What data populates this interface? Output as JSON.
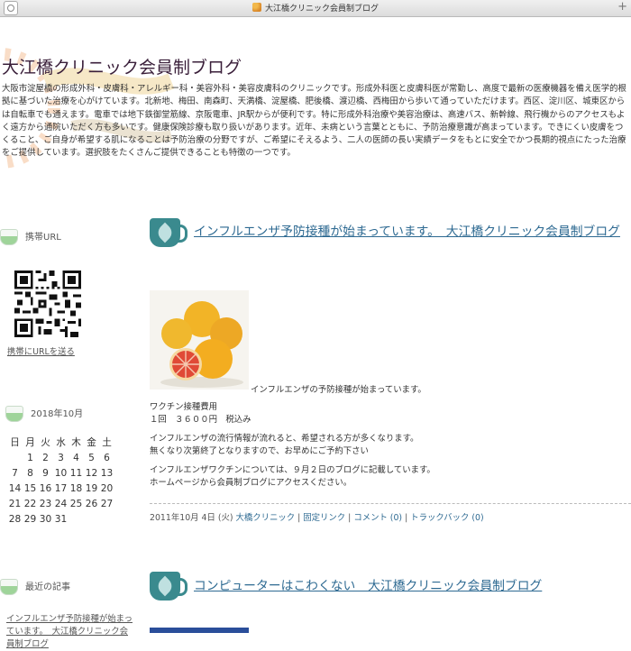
{
  "browser": {
    "tab_title": "大江橋クリニック会員制ブログ",
    "new_tab_symbol": "+"
  },
  "header": {
    "site_title": "大江橋クリニック会員制ブログ",
    "description": "大阪市淀屋橋の形成外科・皮膚科・アレルギー科・美容外科・美容皮膚科のクリニックです。形成外科医と皮膚科医が常勤し、高度で最新の医療機器を備え医学的根拠に基づいた治療を心がけています。北新地、梅田、南森町、天満橋、淀屋橋、肥後橋、渡辺橋、西梅田から歩いて通っていただけます。西区、淀川区、城東区からは自転車でも通えます。電車では地下鉄御堂筋線、京阪電車、JR駅からが便利です。特に形成外科治療や美容治療は、高速バス、新幹線、飛行機からのアクセスもよく遠方から通院いただく方も多いです。健康保険診療も取り扱いがあります。近年、未病という言葉とともに、予防治療意識が高まっています。できにくい皮膚をつくること、ご自身が希望する肌になることは予防治療の分野ですが、ご希望にそえるよう、二人の医師の長い実績データをもとに安全でかつ長期的視点にたった治療をご提供しています。選択肢をたくさんご提供できることも特徴の一つです。"
  },
  "sidebar": {
    "mobile": {
      "heading": "携帯URL",
      "send_link": "携帯にURLを送る"
    },
    "calendar": {
      "heading": "2018年10月",
      "weekdays": [
        "日",
        "月",
        "火",
        "水",
        "木",
        "金",
        "土"
      ],
      "weeks": [
        [
          "",
          "1",
          "2",
          "3",
          "4",
          "5",
          "6"
        ],
        [
          "7",
          "8",
          "9",
          "10",
          "11",
          "12",
          "13"
        ],
        [
          "14",
          "15",
          "16",
          "17",
          "18",
          "19",
          "20"
        ],
        [
          "21",
          "22",
          "23",
          "24",
          "25",
          "26",
          "27"
        ],
        [
          "28",
          "29",
          "30",
          "31",
          "",
          "",
          ""
        ]
      ]
    },
    "recent": {
      "heading": "最近の記事",
      "items": [
        "インフルエンザ予防接種が始まっています。　大江橋クリニック会員制ブログ"
      ]
    }
  },
  "posts": [
    {
      "title": "インフルエンザ予防接種が始まっています。　大江橋クリニック会員制ブログ",
      "image_caption": "インフルエンザの予防接種が始まっています。",
      "paragraphs": [
        "ワクチン接種費用\n１回　３６００円　税込み",
        "インフルエンザの流行情報が流れると、希望される方が多くなります。\n無くなり次第終了となりますので、お早めにご予約下さい",
        "インフルエンザワクチンについては、９月２日のブログに記載しています。\nホームページから会員制ブログにアクセスください。"
      ],
      "meta": {
        "date": "2011年10月 4日 (火)",
        "category": "大橋クリニック",
        "permalink": "固定リンク",
        "comments": "コメント (0)",
        "trackbacks": "トラックバック (0)",
        "separator": "|"
      }
    },
    {
      "title": "コンピューターはこわくない　大江橋クリニック会員制ブログ"
    }
  ],
  "colors": {
    "title": "#3a1f3a",
    "link": "#2e6a92",
    "cup": "#3a8a8e",
    "sidebar_cup": "#9fd49a"
  }
}
